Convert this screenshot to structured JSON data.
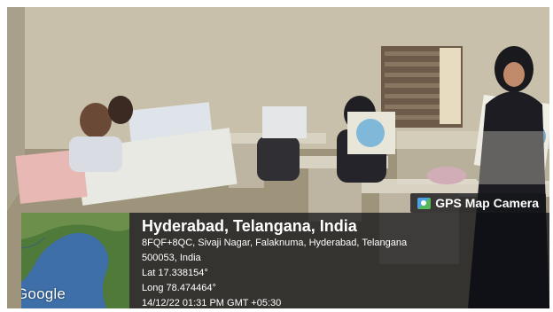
{
  "badge": {
    "label": "GPS Map Camera",
    "icon": "camera-icon"
  },
  "map": {
    "watermark": "Google"
  },
  "location": {
    "title": "Hyderabad, Telangana, India",
    "address_line1": "8FQF+8QC, Sivaji Nagar, Falaknuma, Hyderabad, Telangana",
    "address_line2": "500053, India",
    "lat": "Lat 17.338154°",
    "long": "Long 78.474464°",
    "timestamp": "14/12/22 01:31 PM GMT +05:30"
  },
  "colors": {
    "overlay": "#14161a",
    "wall": "#c9c2ad",
    "map_water": "#3e6fa8",
    "map_land": "#4f7a3a"
  }
}
